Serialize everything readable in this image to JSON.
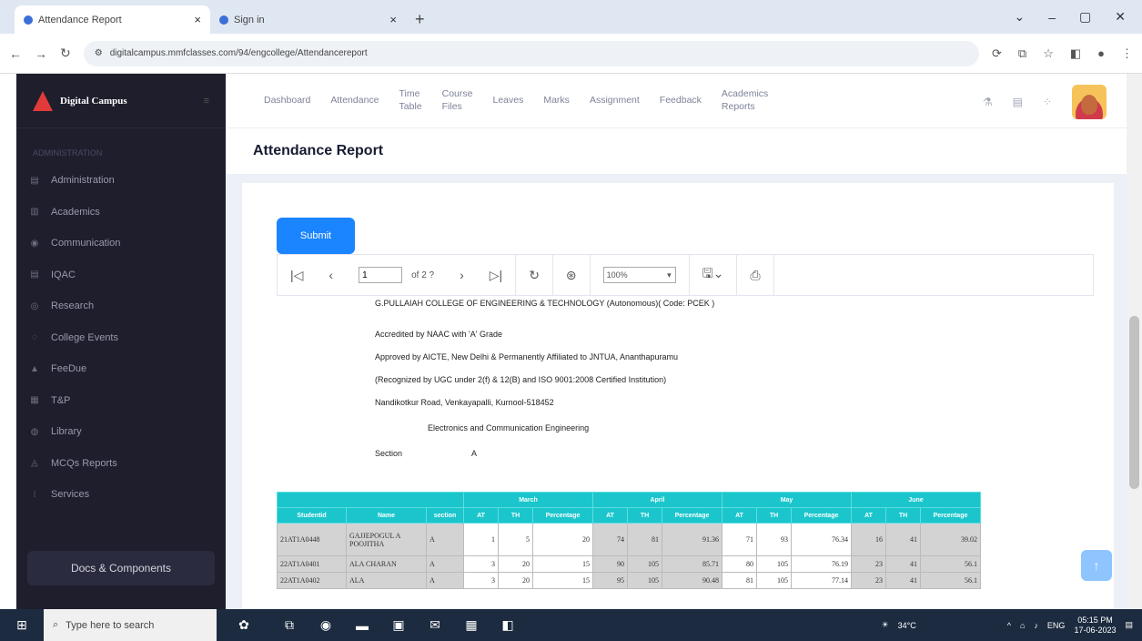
{
  "browser": {
    "tabs": [
      {
        "title": "Attendance Report",
        "close": "×"
      },
      {
        "title": "Sign in",
        "close": "×"
      }
    ],
    "new_tab": "+",
    "url": "digitalcampus.mmfclasses.com/94/engcollege/Attendancereport",
    "window_controls": [
      "⌄",
      "–",
      "▢",
      "✕"
    ]
  },
  "sidebar": {
    "brand": "Digital Campus",
    "section": "ADMINISTRATION",
    "items": [
      {
        "label": "Administration"
      },
      {
        "label": "Academics"
      },
      {
        "label": "Communication"
      },
      {
        "label": "IQAC"
      },
      {
        "label": "Research"
      },
      {
        "label": "College Events"
      },
      {
        "label": "FeeDue"
      },
      {
        "label": "T&P"
      },
      {
        "label": "Library"
      },
      {
        "label": "MCQs Reports"
      },
      {
        "label": "Services"
      }
    ],
    "docs_button": "Docs & Components"
  },
  "topnav": {
    "items": [
      [
        "Dashboard"
      ],
      [
        "Attendance"
      ],
      [
        "Time",
        "Table"
      ],
      [
        "Course",
        "Files"
      ],
      [
        "Leaves"
      ],
      [
        "Marks"
      ],
      [
        "Assignment"
      ],
      [
        "Feedback"
      ],
      [
        "Academics",
        "Reports"
      ]
    ]
  },
  "page_title": "Attendance Report",
  "submit_label": "Submit",
  "viewer": {
    "page_value": "1",
    "page_of": "of 2 ?",
    "zoom": "100%"
  },
  "report": {
    "lines": [
      "G.PULLAIAH COLLEGE OF ENGINEERING & TECHNOLOGY (Autonomous)( Code: PCEK )",
      "Accredited by NAAC with 'A' Grade",
      "Approved by AICTE, New Delhi & Permanently Affiliated to JNTUA, Ananthapuramu",
      "(Recognized by UGC under 2(f) & 12(B) and ISO 9001:2008 Certified Institution)",
      "Nandikotkur Road, Venkayapalli, Kurnool-518452",
      "Electronics and Communication Engineering"
    ],
    "section_label": "Section",
    "section_value": "A"
  },
  "table": {
    "months": [
      "March",
      "April",
      "May",
      "June"
    ],
    "headers": [
      "Studentid",
      "Name",
      "section",
      "AT",
      "TH",
      "Percentage",
      "AT",
      "TH",
      "Percentage",
      "AT",
      "TH",
      "Percentage",
      "AT",
      "TH",
      "Percentage"
    ],
    "rows": [
      [
        "21AT1A0448",
        "GAJJEPOGUL A POOJITHA",
        "A",
        "1",
        "5",
        "20",
        "74",
        "81",
        "91.36",
        "71",
        "93",
        "76.34",
        "16",
        "41",
        "39.02"
      ],
      [
        "22AT1A0401",
        "ALA CHARAN",
        "A",
        "3",
        "20",
        "15",
        "90",
        "105",
        "85.71",
        "80",
        "105",
        "76.19",
        "23",
        "41",
        "56.1"
      ],
      [
        "22AT1A0402",
        "ALA",
        "A",
        "3",
        "20",
        "15",
        "95",
        "105",
        "90.48",
        "81",
        "105",
        "77.14",
        "23",
        "41",
        "56.1"
      ]
    ]
  },
  "taskbar": {
    "search_placeholder": "Type here to search",
    "weather": "34°C",
    "lang": "ENG",
    "time": "05:15 PM",
    "date": "17-06-2023"
  }
}
